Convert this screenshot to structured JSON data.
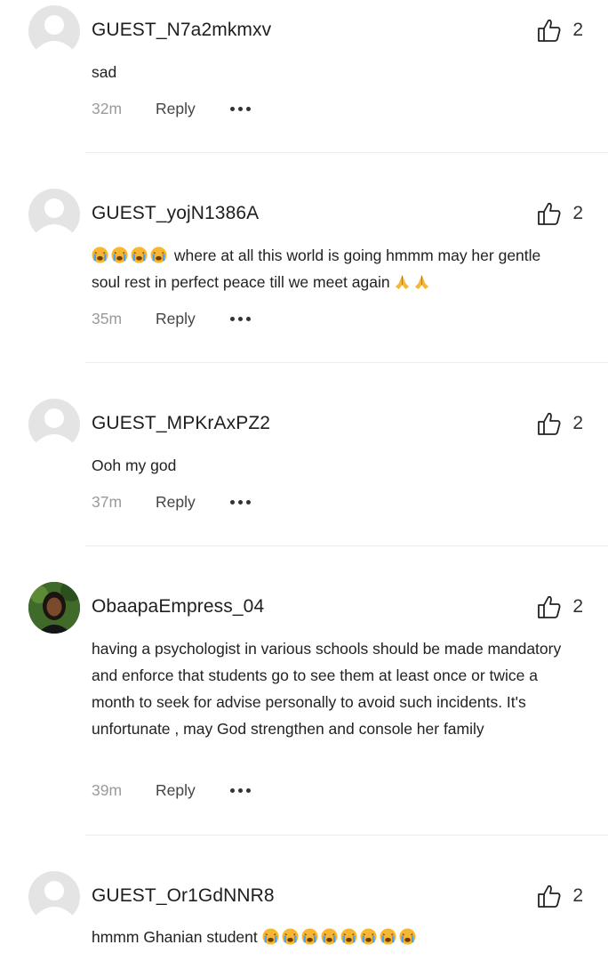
{
  "comments": [
    {
      "username": "GUEST_N7a2mkmxv",
      "likes": "2",
      "time": "32m",
      "reply": "Reply",
      "text": "sad",
      "avatar": "default-avatar-icon"
    },
    {
      "username": "GUEST_yojN1386A",
      "likes": "2",
      "time": "35m",
      "reply": "Reply",
      "text_line1": "where at all this world is going hmmm may her gentle",
      "text_line2": "soul rest in perfect peace till we meet again",
      "avatar": "default-avatar-icon",
      "emoji_lead": "crying-face-emoji",
      "emoji_trail": "praying-hands-emoji"
    },
    {
      "username": "GUEST_MPKrAxPZ2",
      "likes": "2",
      "time": "37m",
      "reply": "Reply",
      "text": "Ooh my god",
      "avatar": "default-avatar-icon"
    },
    {
      "username": "ObaapaEmpress_04",
      "likes": "2",
      "time": "39m",
      "reply": "Reply",
      "text": "having a psychologist in various schools should be made mandatory and enforce that students go to see them at least once or twice a month to seek for advise personally to avoid such incidents. It's unfortunate , may God strengthen and console her family",
      "avatar": "user-photo-avatar"
    },
    {
      "username": "GUEST_Or1GdNNR8",
      "likes": "2",
      "text": "hmmm Ghanian student",
      "avatar": "default-avatar-icon",
      "emoji_trail": "crying-face-emoji"
    }
  ],
  "colors": {
    "divider": "#ececec",
    "time": "#9a9a9a",
    "avatar_bg": "#e4e4e4"
  }
}
